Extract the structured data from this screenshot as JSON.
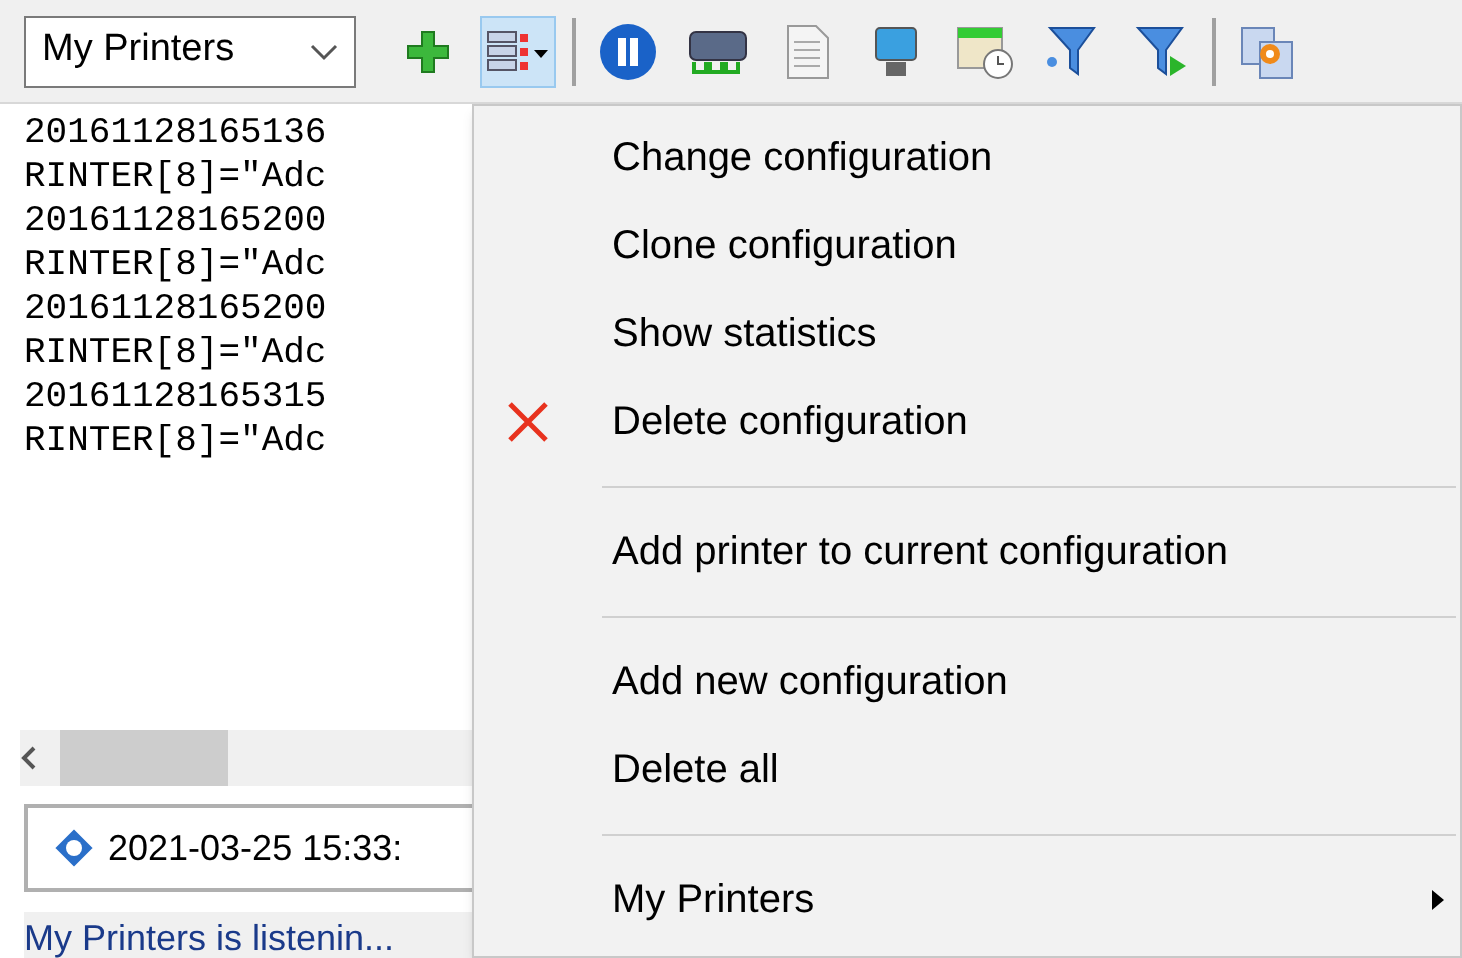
{
  "toolbar": {
    "printer_select": {
      "value": "My Printers"
    },
    "buttons": [
      {
        "kind": "add",
        "selected": false
      },
      {
        "kind": "config",
        "selected": true
      },
      {
        "kind": "separator"
      },
      {
        "kind": "pause",
        "selected": false
      },
      {
        "kind": "port",
        "selected": false
      },
      {
        "kind": "document",
        "selected": false
      },
      {
        "kind": "monitor",
        "selected": false
      },
      {
        "kind": "schedule",
        "selected": false
      },
      {
        "kind": "filter",
        "selected": false
      },
      {
        "kind": "filter-play",
        "selected": false
      },
      {
        "kind": "separator"
      },
      {
        "kind": "settings",
        "selected": false
      }
    ]
  },
  "log_lines": [
    "20161128165136",
    "RINTER[8]=\"Adc",
    "20161128165200",
    "RINTER[8]=\"Adc",
    "20161128165200",
    "RINTER[8]=\"Adc",
    "20161128165315",
    "RINTER[8]=\"Adc"
  ],
  "status_field": {
    "text": "2021-03-25 15:33:"
  },
  "status_text": "My Printers is listenin...",
  "menu": [
    {
      "kind": "item",
      "label": "Change configuration"
    },
    {
      "kind": "item",
      "label": "Clone configuration"
    },
    {
      "kind": "item",
      "label": "Show statistics"
    },
    {
      "kind": "delete",
      "label": "Delete configuration"
    },
    {
      "kind": "separator"
    },
    {
      "kind": "item",
      "label": "Add printer to current configuration"
    },
    {
      "kind": "separator"
    },
    {
      "kind": "item",
      "label": "Add new configuration"
    },
    {
      "kind": "item",
      "label": "Delete all"
    },
    {
      "kind": "separator"
    },
    {
      "kind": "submenu",
      "label": "My Printers"
    }
  ]
}
